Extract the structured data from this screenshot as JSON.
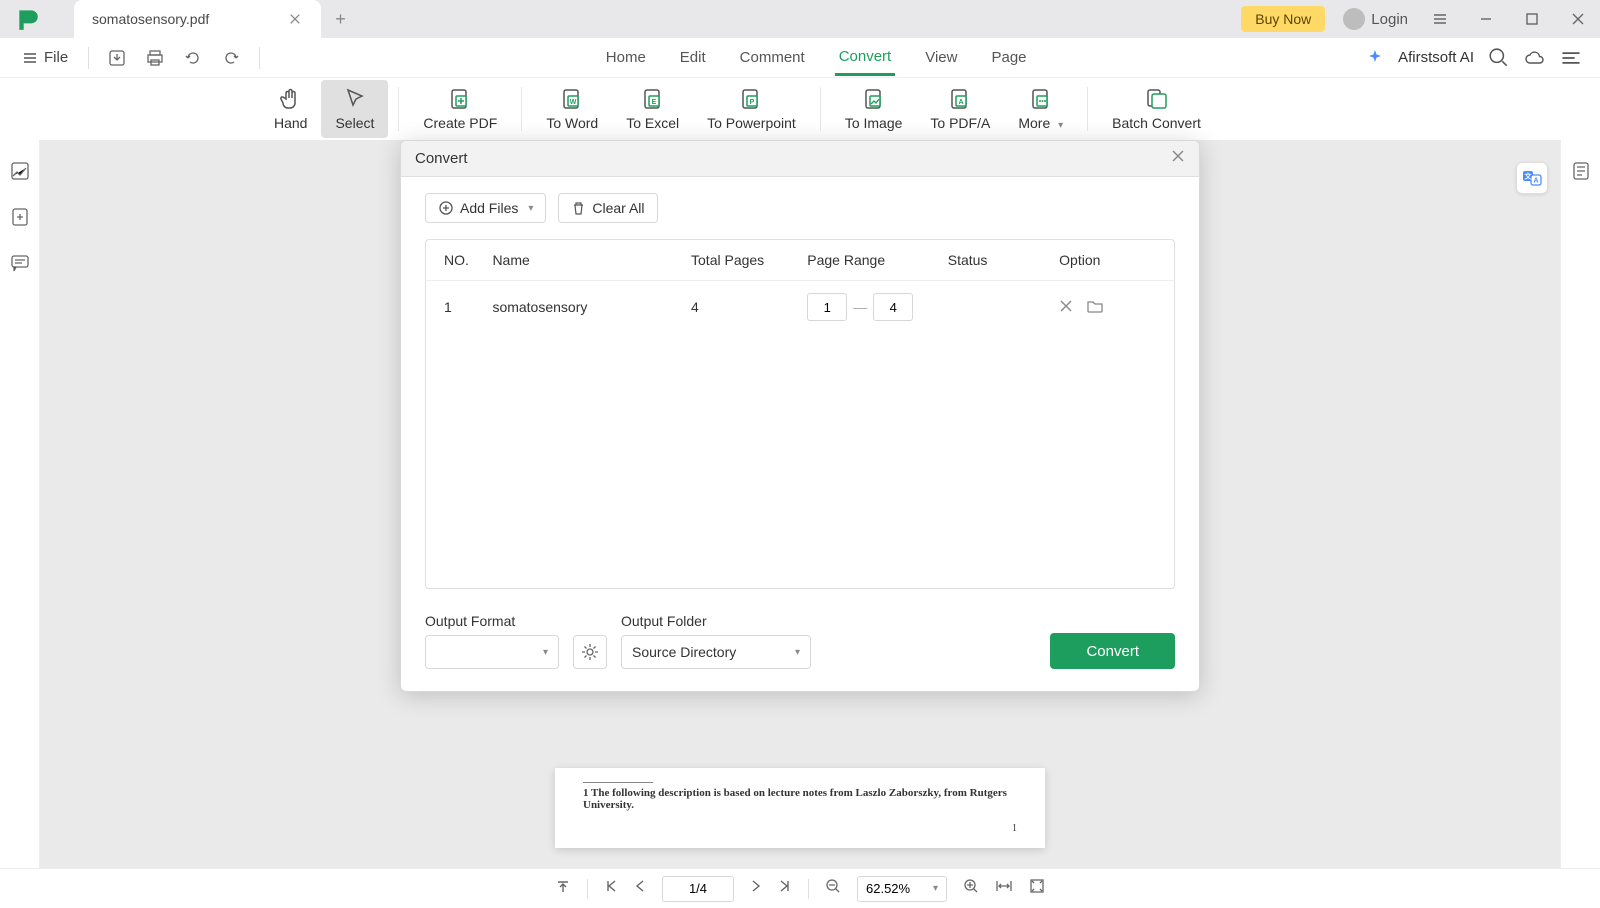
{
  "titlebar": {
    "tab_title": "somatosensory.pdf",
    "buy_now": "Buy Now",
    "login": "Login"
  },
  "menubar": {
    "file": "File",
    "tabs": [
      "Home",
      "Edit",
      "Comment",
      "Convert",
      "View",
      "Page"
    ],
    "active_tab": "Convert",
    "ai_label": "Afirstsoft AI"
  },
  "toolbar": {
    "items": [
      "Hand",
      "Select",
      "Create PDF",
      "To Word",
      "To Excel",
      "To Powerpoint",
      "To Image",
      "To PDF/A",
      "More",
      "Batch Convert"
    ],
    "selected": "Select"
  },
  "dialog": {
    "title": "Convert",
    "add_files": "Add Files",
    "clear_all": "Clear All",
    "columns": {
      "no": "NO.",
      "name": "Name",
      "pages": "Total Pages",
      "range": "Page Range",
      "status": "Status",
      "option": "Option"
    },
    "rows": [
      {
        "no": "1",
        "name": "somatosensory",
        "pages": "4",
        "range_from": "1",
        "range_to": "4",
        "status": ""
      }
    ],
    "output_format_label": "Output Format",
    "output_format_value": "",
    "output_folder_label": "Output Folder",
    "output_folder_value": "Source Directory",
    "convert_btn": "Convert"
  },
  "page_preview": {
    "footnote": "1 The following description is based on lecture notes from Laszlo Zaborszky, from Rutgers University.",
    "page_num": "1"
  },
  "statusbar": {
    "page": "1/4",
    "zoom": "62.52%"
  }
}
